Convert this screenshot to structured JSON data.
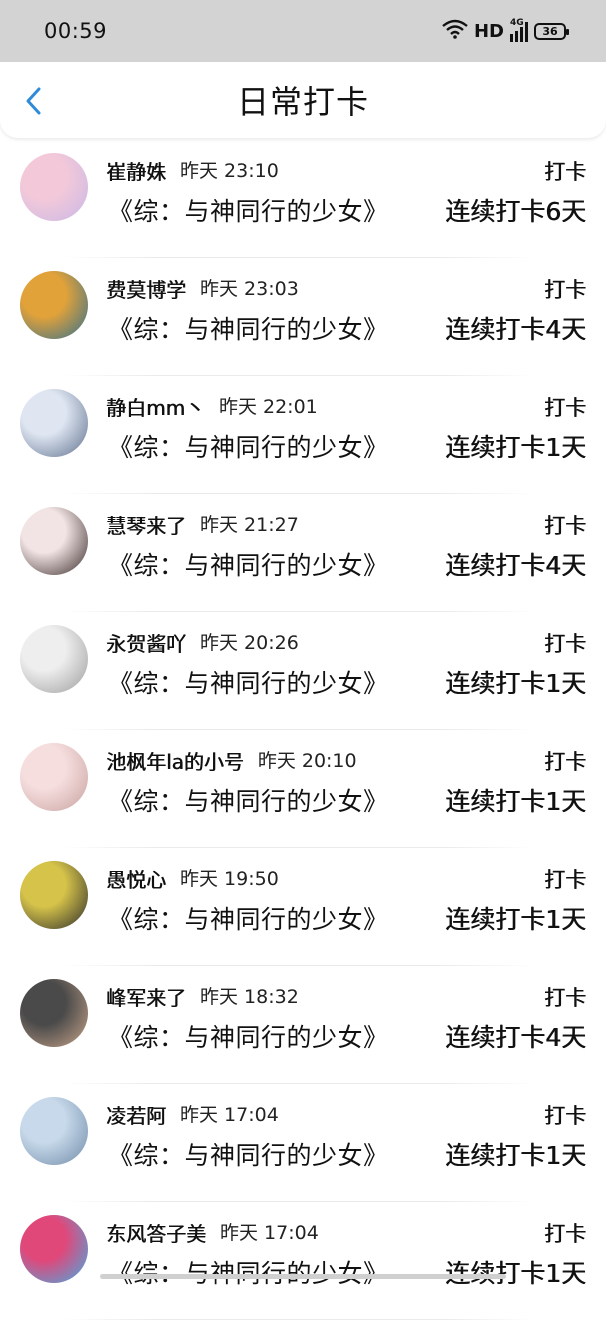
{
  "status": {
    "time": "00:59",
    "hd": "HD",
    "net": "4G",
    "battery": "36"
  },
  "header": {
    "title": "日常打卡"
  },
  "checkin_label": "打卡",
  "items": [
    {
      "name": "崔静姝",
      "time": "昨天 23:10",
      "book": "《综：与神同行的少女》",
      "streak": "连续打卡6天",
      "avatar_colors": [
        "#f3c9d9",
        "#c9b7e6"
      ]
    },
    {
      "name": "费莫博学",
      "time": "昨天 23:03",
      "book": "《综：与神同行的少女》",
      "streak": "连续打卡4天",
      "avatar_colors": [
        "#e2a23a",
        "#2f6f8f"
      ]
    },
    {
      "name": "静白mm丶",
      "time": "昨天 22:01",
      "book": "《综：与神同行的少女》",
      "streak": "连续打卡1天",
      "avatar_colors": [
        "#dfe6f2",
        "#5d6f8c"
      ]
    },
    {
      "name": "慧琴来了",
      "time": "昨天 21:27",
      "book": "《综：与神同行的少女》",
      "streak": "连续打卡4天",
      "avatar_colors": [
        "#f2e4e4",
        "#3a2a2a"
      ]
    },
    {
      "name": "永贺酱吖",
      "time": "昨天 20:26",
      "book": "《综：与神同行的少女》",
      "streak": "连续打卡1天",
      "avatar_colors": [
        "#eeeeee",
        "#9c9c9c"
      ]
    },
    {
      "name": "池枫年la的小号",
      "time": "昨天 20:10",
      "book": "《综：与神同行的少女》",
      "streak": "连续打卡1天",
      "avatar_colors": [
        "#f6dede",
        "#c7a2a0"
      ]
    },
    {
      "name": "愚悦心",
      "time": "昨天 19:50",
      "book": "《综：与神同行的少女》",
      "streak": "连续打卡1天",
      "avatar_colors": [
        "#d6c34a",
        "#2a2a2a"
      ]
    },
    {
      "name": "峰军来了",
      "time": "昨天 18:32",
      "book": "《综：与神同行的少女》",
      "streak": "连续打卡4天",
      "avatar_colors": [
        "#4a4a4a",
        "#c9a58a"
      ]
    },
    {
      "name": "凌若阿",
      "time": "昨天 17:04",
      "book": "《综：与神同行的少女》",
      "streak": "连续打卡1天",
      "avatar_colors": [
        "#c7d9ea",
        "#6f8aa8"
      ]
    },
    {
      "name": "东风答子美",
      "time": "昨天 17:04",
      "book": "《综：与神同行的少女》",
      "streak": "连续打卡1天",
      "avatar_colors": [
        "#e0487a",
        "#3fb0e6"
      ]
    }
  ]
}
